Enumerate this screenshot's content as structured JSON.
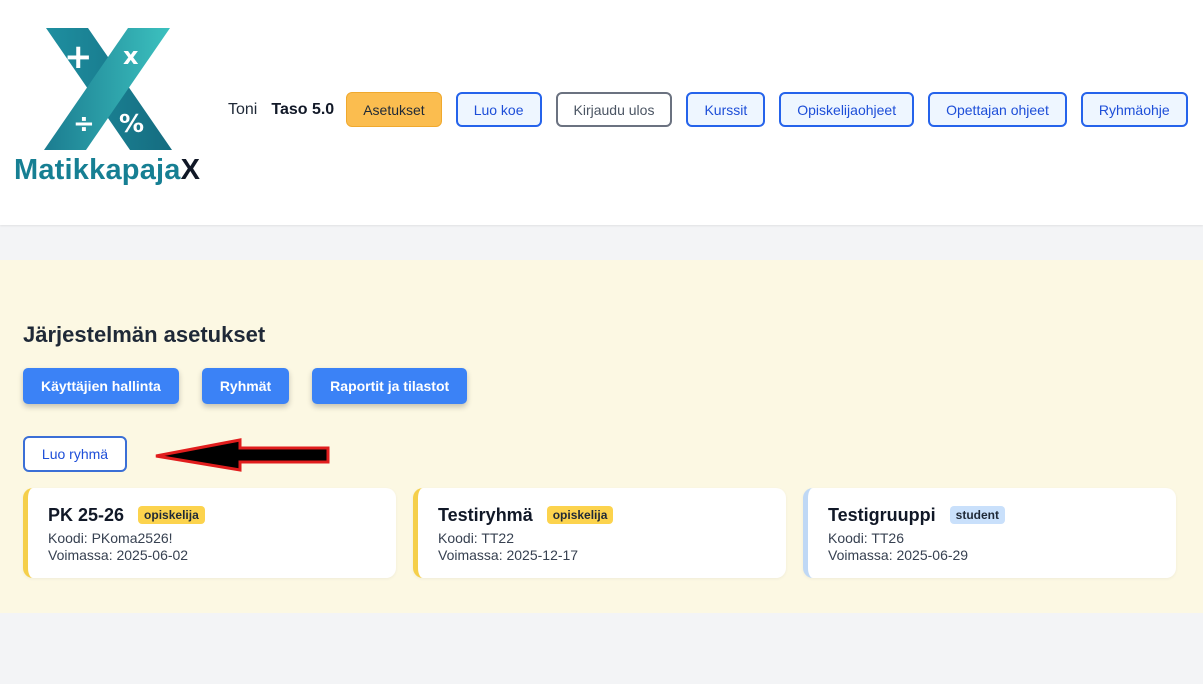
{
  "brand": {
    "logo_text_main": "Matikkapaja",
    "logo_text_accent": "X",
    "logo_symbols": [
      "+",
      "x",
      "÷",
      "%"
    ]
  },
  "header": {
    "user_name": "Toni",
    "user_level": "Taso 5.0",
    "buttons": {
      "settings": "Asetukset",
      "create_exam": "Luo koe",
      "logout": "Kirjaudu ulos",
      "courses": "Kurssit",
      "student_guide": "Opiskelijaohjeet",
      "teacher_guide": "Opettajan ohjeet",
      "group_guide": "Ryhmäohje"
    }
  },
  "system_settings": {
    "title": "Järjestelmän asetukset",
    "buttons": {
      "user_management": "Käyttäjien hallinta",
      "groups": "Ryhmät",
      "reports": "Raportit ja tilastot"
    },
    "create_group": "Luo ryhmä"
  },
  "groups": [
    {
      "name": "PK 25-26",
      "role": "opiskelija",
      "code": "Koodi: PKoma2526!",
      "valid": "Voimassa: 2025-06-02"
    },
    {
      "name": "Testiryhmä",
      "role": "opiskelija",
      "code": "Koodi: TT22",
      "valid": "Voimassa: 2025-12-17"
    },
    {
      "name": "Testigruuppi",
      "role": "student",
      "code": "Koodi: TT26",
      "valid": "Voimassa: 2025-06-29"
    }
  ],
  "colors": {
    "primary": "#3b82f6",
    "accent_orange": "#fbbd4f",
    "panel_bg": "#fcf8e3",
    "logo_teal": "#167f93",
    "annotation_arrow": "#e11d1d"
  }
}
